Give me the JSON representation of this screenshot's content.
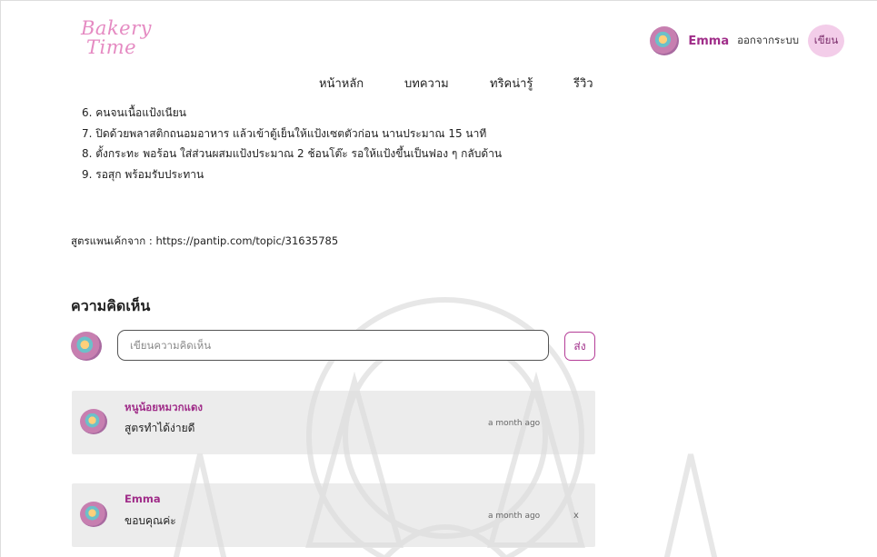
{
  "header": {
    "logo_line1": "Bakery",
    "logo_line2": "Time",
    "user_name": "Emma",
    "logout_label": "ออกจากระบบ",
    "write_label": "เขียน"
  },
  "nav": {
    "items": [
      "หน้าหลัก",
      "บทความ",
      "ทริคน่ารู้",
      "รีวิว"
    ]
  },
  "article": {
    "steps": [
      "6. คนจนเนื้อแป้งเนียน",
      "7. ปิดด้วยพลาสติกถนอมอาหาร แล้วเข้าตู้เย็นให้แป้งเซตตัวก่อน นานประมาณ 15 นาที",
      "8. ตั้งกระทะ พอร้อน ใส่ส่วนผสมแป้งประมาณ 2 ช้อนโต๊ะ รอให้แป้งขึ้นเป็นฟอง ๆ กลับด้าน",
      "9. รอสุก พร้อมรับประทาน"
    ],
    "source": "สูตรแพนเค้กจาก : https://pantip.com/topic/31635785"
  },
  "comments": {
    "title": "ความคิดเห็น",
    "input_placeholder": "เขียนความคิดเห็น",
    "send_label": "ส่ง",
    "items": [
      {
        "author": "หนูน้อยหมวกแดง",
        "text": "สูตรทำได้ง่ายดี",
        "time": "a month ago"
      },
      {
        "author": "Emma",
        "text": "ขอบคุณค่ะ",
        "time": "a month ago",
        "delete_label": "x"
      }
    ]
  },
  "colors": {
    "accent": "#a02d89",
    "logo": "#e58ac2",
    "write_button_bg": "#f3cde9"
  }
}
